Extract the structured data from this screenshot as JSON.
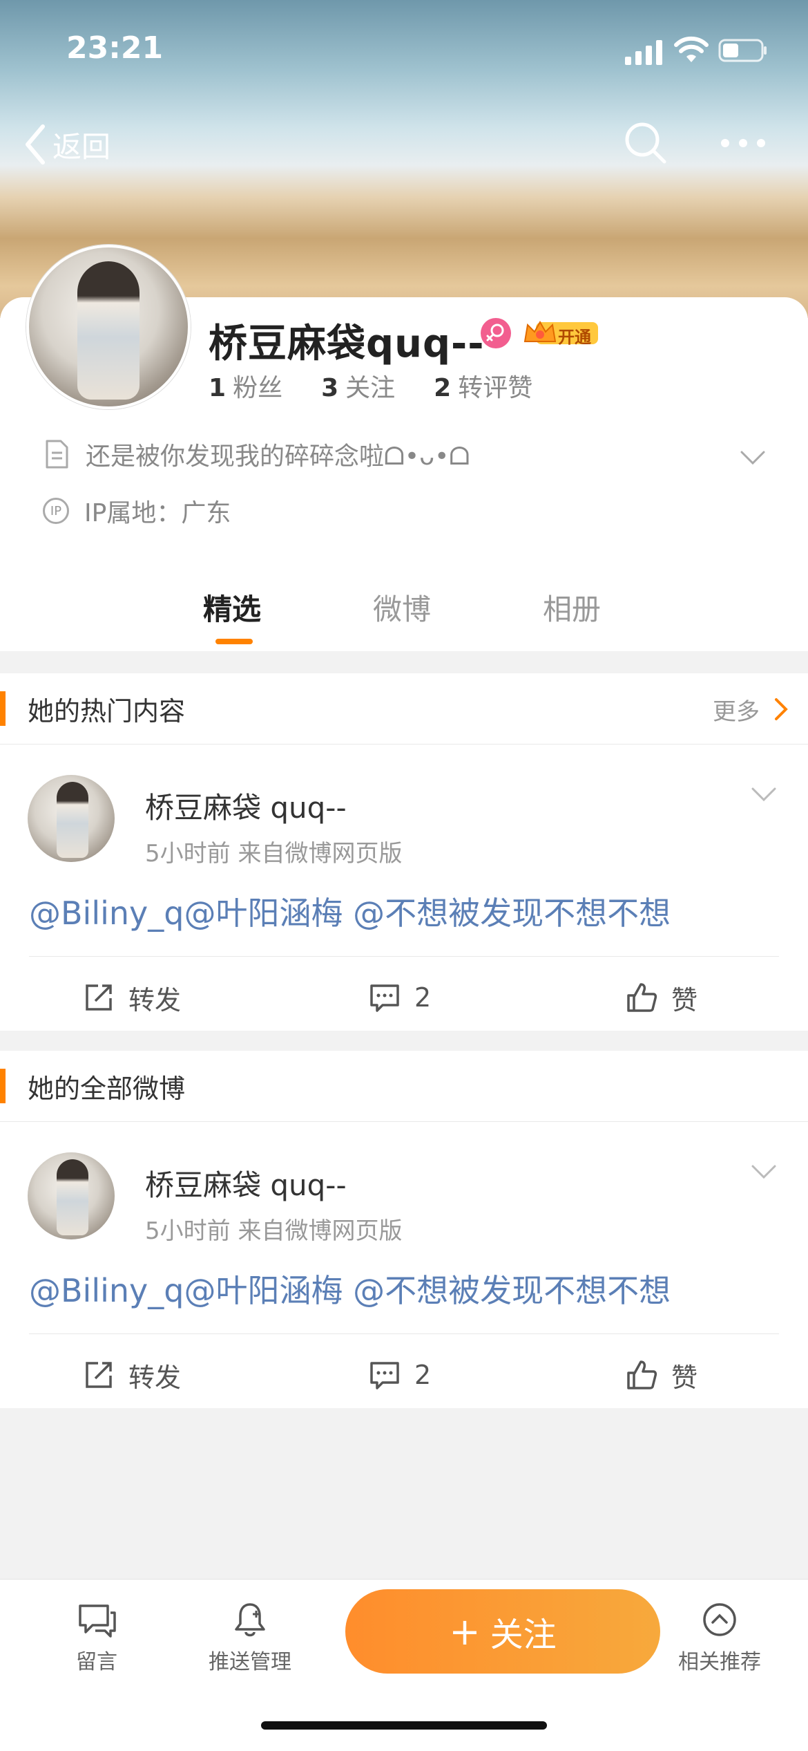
{
  "status": {
    "time": "23:21"
  },
  "nav": {
    "back_label": "返回"
  },
  "profile": {
    "username": "桥豆麻袋quq--",
    "vip_label": "开通",
    "stats": [
      {
        "value": "1",
        "label": "粉丝"
      },
      {
        "value": "3",
        "label": "关注"
      },
      {
        "value": "2",
        "label": "转评赞"
      }
    ],
    "bio": "还是被你发现我的碎碎念啦ᗝ•ᴗ•ᗝ",
    "ip_icon_text": "IP",
    "ip_location": "IP属地：广东"
  },
  "tabs": [
    {
      "label": "精选",
      "active": true
    },
    {
      "label": "微博",
      "active": false
    },
    {
      "label": "相册",
      "active": false
    }
  ],
  "hot_section": {
    "title": "她的热门内容",
    "more": "更多"
  },
  "all_section": {
    "title": "她的全部微博"
  },
  "posts": [
    {
      "author": "桥豆麻袋 quq--",
      "meta": "5小时前  来自微博网页版",
      "text": "@Biliny_q@叶阳涵梅 @不想被发现不想不想",
      "repost_label": "转发",
      "comment_count": "2",
      "like_label": "赞"
    },
    {
      "author": "桥豆麻袋 quq--",
      "meta": "5小时前  来自微博网页版",
      "text": "@Biliny_q@叶阳涵梅 @不想被发现不想不想",
      "repost_label": "转发",
      "comment_count": "2",
      "like_label": "赞"
    }
  ],
  "bottom_bar": {
    "message_label": "留言",
    "push_label": "推送管理",
    "follow_plus": "+",
    "follow_label": "关注",
    "recommend_label": "相关推荐"
  },
  "colors": {
    "accent": "#ff8200",
    "link": "#5b7fb6",
    "female": "#f25e8f"
  }
}
